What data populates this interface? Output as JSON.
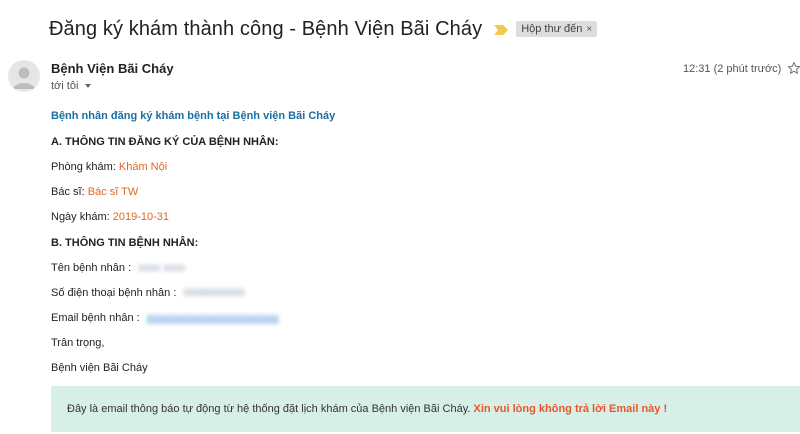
{
  "email": {
    "subject": "Đăng ký khám thành công - Bệnh Viện Bãi Cháy",
    "label_chip": "Hộp thư đến",
    "label_chip_close": "×",
    "sender": "Bệnh Viện Bãi Cháy",
    "recipient": "tới tôi",
    "timestamp": "12:31 (2 phút trước)"
  },
  "body": {
    "intro": "Bệnh nhân đăng ký khám bệnh tại Bệnh viện Bãi Cháy",
    "section_a_title": "A. THÔNG TIN ĐĂNG KÝ CỦA BỆNH NHÂN:",
    "clinic_label": "Phòng khám:",
    "clinic_value": "Khám Nội",
    "doctor_label": "Bác sĩ:",
    "doctor_value": "Bác sĩ TW",
    "date_label": "Ngày khám:",
    "date_value": "2019-10-31",
    "section_b_title": "B. THÔNG TIN BỆNH NHÂN:",
    "name_label": "Tên bệnh nhân :",
    "phone_label": "Số điện thoại bệnh nhân :",
    "email_label": "Email bệnh nhân :",
    "closing": "Trân trọng,",
    "signature": "Bệnh viện Bãi Cháy"
  },
  "footer": {
    "notice": "Đây là email thông báo tự động từ hệ thống đặt lịch khám của Bệnh viện Bãi Cháy.",
    "warning": "Xin vui lòng không trả lời Email này !"
  },
  "colors": {
    "accent_blue": "#1a6fa0",
    "value_orange": "#e06623",
    "footer_bg": "#d7efe6",
    "importance_yellow": "#f2c94c"
  },
  "icons": {
    "importance": "importance-marker-icon",
    "avatar": "default-avatar-icon",
    "star": "star-icon",
    "dropdown": "caret-down-icon"
  }
}
